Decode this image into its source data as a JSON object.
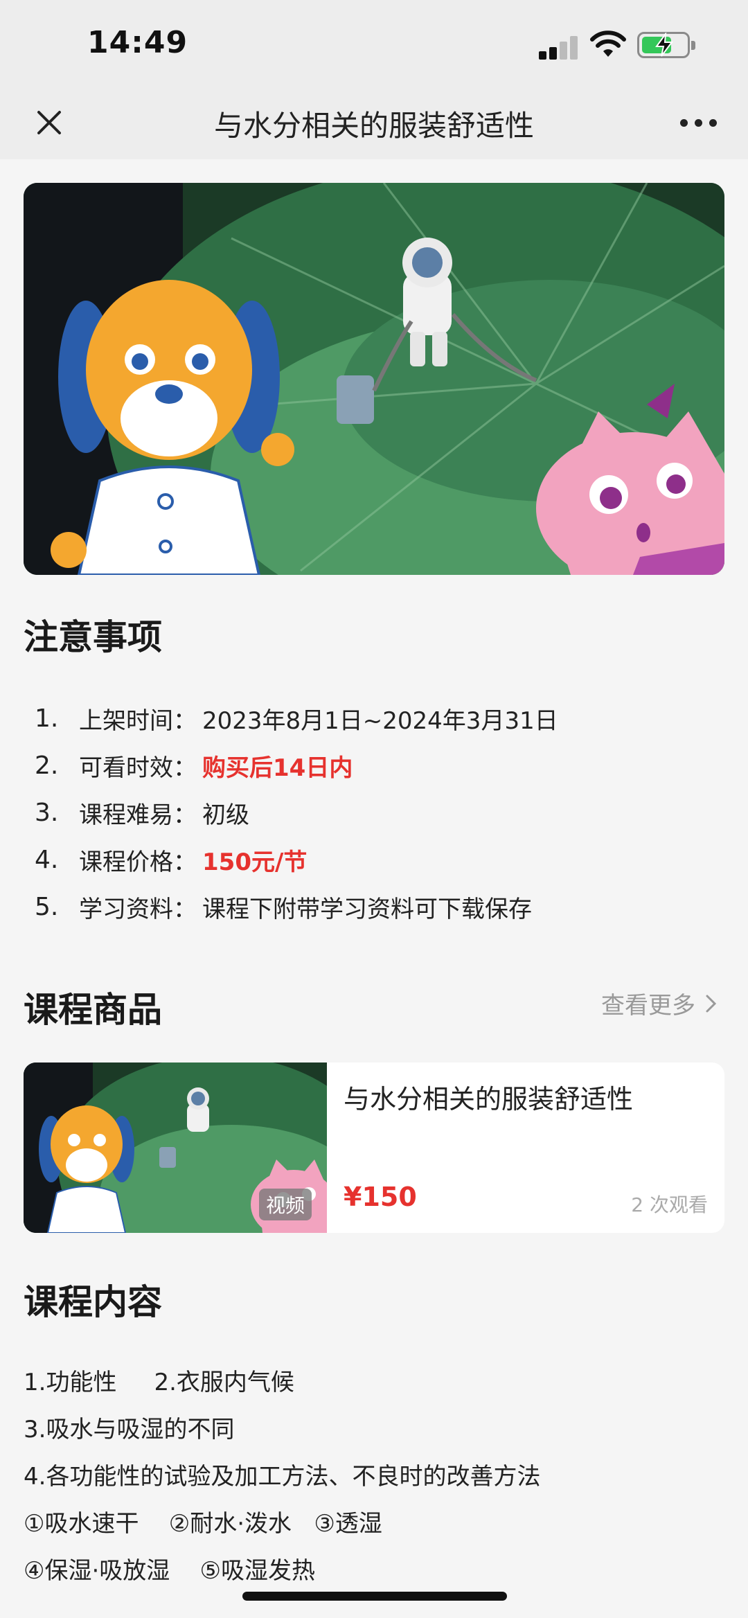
{
  "status_bar": {
    "time": "14:49"
  },
  "nav": {
    "title": "与水分相关的服装舒适性"
  },
  "notice": {
    "title": "注意事项",
    "items": [
      {
        "num": "1.",
        "key": "上架时间：",
        "value": "2023年8月1日~2024年3月31日",
        "highlight": false
      },
      {
        "num": "2.",
        "key": "可看时效：",
        "value": "购买后14日内",
        "highlight": true
      },
      {
        "num": "3.",
        "key": "课程难易：",
        "value": "初级",
        "highlight": false
      },
      {
        "num": "4.",
        "key": "课程价格：",
        "value": "150元/节",
        "highlight": true
      },
      {
        "num": "5.",
        "key": "学习资料：",
        "value": "课程下附带学习资料可下载保存",
        "highlight": false
      }
    ]
  },
  "products": {
    "title": "课程商品",
    "more": "查看更多",
    "item": {
      "title": "与水分相关的服装舒适性",
      "tag": "视频",
      "price": "¥150",
      "views": "2 次观看"
    }
  },
  "content": {
    "title": "课程内容",
    "lines": [
      "1.功能性     2.衣服内气候",
      "3.吸水与吸湿的不同",
      "4.各功能性的试验及加工方法、不良时的改善方法",
      "①吸水速干    ②耐水·泼水   ③透湿",
      "④保湿·吸放湿    ⑤吸湿发热"
    ]
  },
  "colors": {
    "accent_red": "#e6322e",
    "bar_bg": "#ededed",
    "page_bg": "#f5f5f5"
  }
}
